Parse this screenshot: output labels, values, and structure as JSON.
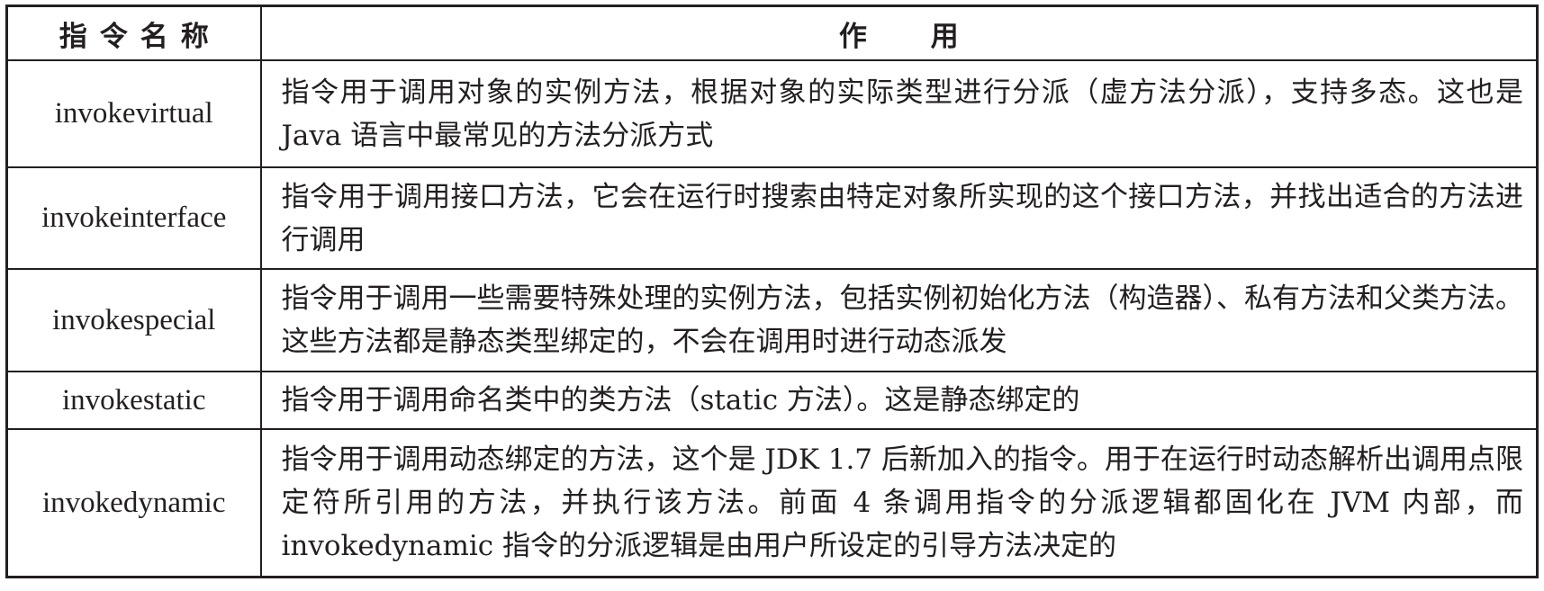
{
  "table": {
    "headers": {
      "name": "指令名称",
      "purpose": "作 用"
    },
    "rows": [
      {
        "name": "invokevirtual",
        "purpose": "指令用于调用对象的实例方法，根据对象的实际类型进行分派（虚方法分派），支持多态。这也是 Java 语言中最常见的方法分派方式"
      },
      {
        "name": "invokeinterface",
        "purpose": "指令用于调用接口方法，它会在运行时搜索由特定对象所实现的这个接口方法，并找出适合的方法进行调用"
      },
      {
        "name": "invokespecial",
        "purpose": "指令用于调用一些需要特殊处理的实例方法，包括实例初始化方法（构造器）、私有方法和父类方法。这些方法都是静态类型绑定的，不会在调用时进行动态派发"
      },
      {
        "name": "invokestatic",
        "purpose": "指令用于调用命名类中的类方法（static 方法）。这是静态绑定的"
      },
      {
        "name": "invokedynamic",
        "purpose": "指令用于调用动态绑定的方法，这个是 JDK 1.7 后新加入的指令。用于在运行时动态解析出调用点限定符所引用的方法，并执行该方法。前面 4 条调用指令的分派逻辑都固化在 JVM 内部，而 invokedynamic 指令的分派逻辑是由用户所设定的引导方法决定的"
      }
    ]
  }
}
